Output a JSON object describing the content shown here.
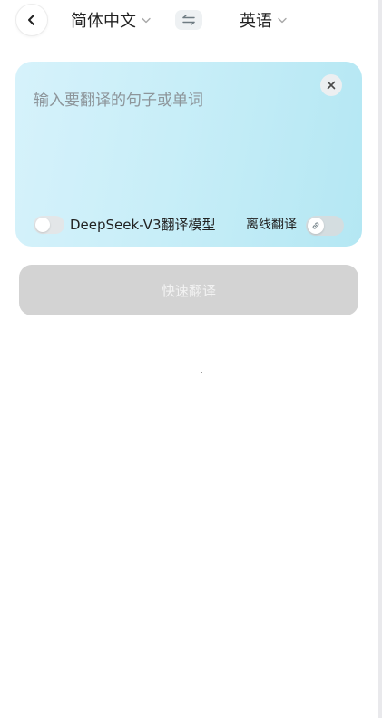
{
  "header": {
    "back_icon": "chevron-left-icon",
    "source_language": "简体中文",
    "target_language": "英语",
    "swap_icon": "swap-arrows-icon",
    "dropdown_icon": "chevron-down-icon"
  },
  "card": {
    "input_value": "",
    "input_placeholder": "输入要翻译的句子或单词",
    "clear_icon": "close-icon",
    "model_toggle_label": "DeepSeek-V3翻译模型",
    "model_toggle_on": false,
    "offline_label": "离线翻译",
    "offline_toggle_on": false,
    "offline_toggle_icon": "link-icon"
  },
  "action": {
    "translate_label": "快速翻译",
    "enabled": false
  },
  "colors": {
    "card_gradient_start": "#d6f2fb",
    "card_gradient_end": "#b4e7f3",
    "button_disabled_bg": "#d3d3d3",
    "button_disabled_text": "#f2f2f2"
  }
}
